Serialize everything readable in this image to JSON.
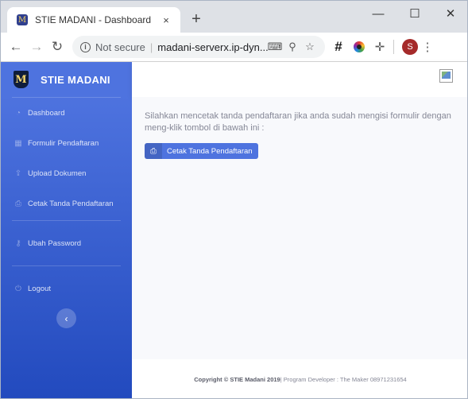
{
  "browser": {
    "tab_title": "STIE MADANI - Dashboard",
    "tab_close": "×",
    "new_tab": "+",
    "minimize": "—",
    "maximize": "☐",
    "close": "✕",
    "security_label": "Not secure",
    "url": "madani-serverx.ip-dyn...",
    "avatar_letter": "S"
  },
  "sidebar": {
    "brand": "STIE MADANI",
    "items": [
      {
        "label": "Dashboard",
        "icon": "tachometer-icon"
      },
      {
        "label": "Formulir Pendaftaran",
        "icon": "table-icon"
      },
      {
        "label": "Upload Dokumen",
        "icon": "upload-icon"
      },
      {
        "label": "Cetak Tanda Pendaftaran",
        "icon": "print-icon"
      },
      {
        "label": "Ubah Password",
        "icon": "key-icon"
      },
      {
        "label": "Logout",
        "icon": "power-icon"
      }
    ],
    "toggle": "‹"
  },
  "main": {
    "message": "Silahkan mencetak tanda pendaftaran jika anda sudah mengisi formulir dengan meng-klik tombol di bawah ini :",
    "button_label": "Cetak Tanda Pendaftaran"
  },
  "footer": {
    "copyright": "Copyright © STIE Madani 2019",
    "credit": " | Program Developer : The Maker 08971231654"
  },
  "colors": {
    "sidebar_top": "#4e73df",
    "sidebar_bottom": "#224abe",
    "button": "#4e73df",
    "text_muted": "#858796"
  }
}
